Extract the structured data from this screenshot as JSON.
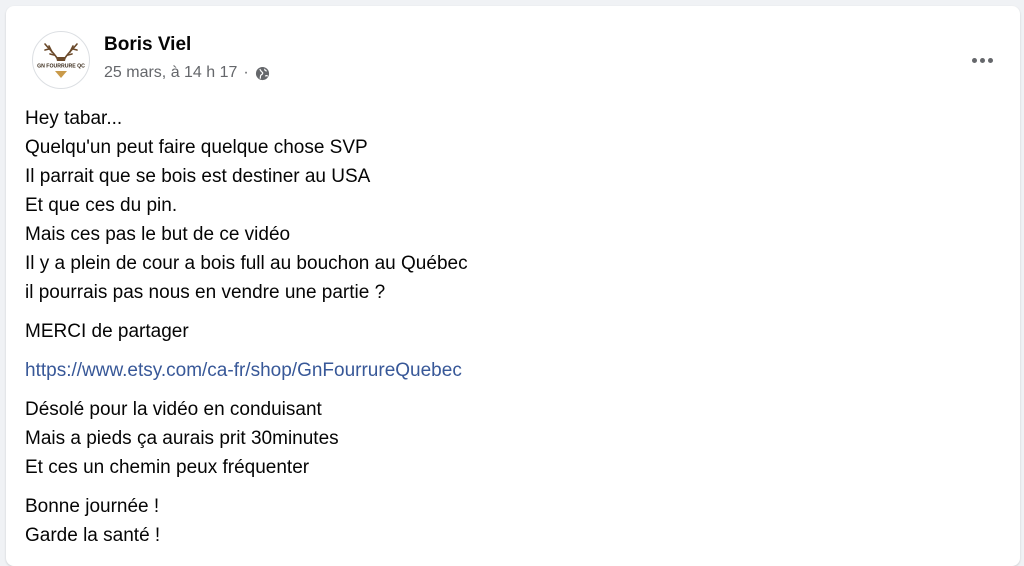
{
  "post": {
    "author": "Boris Viel",
    "avatar_text": "GN FOURRURE QC",
    "timestamp": "25 mars, à 14 h 17",
    "separator": "·",
    "privacy_icon": "globe-icon",
    "more_icon": "more-options-icon"
  },
  "body": {
    "para1": [
      "Hey tabar...",
      "Quelqu'un peut faire quelque chose SVP",
      "Il parrait que se bois est destiner au USA",
      "Et que ces du pin.",
      "Mais ces pas le but de ce vidéo",
      "Il y a plein de cour a bois full au bouchon au Québec",
      "il pourrais pas nous en vendre une partie ?"
    ],
    "para2": "MERCI de partager",
    "link": "https://www.etsy.com/ca-fr/shop/GnFourrureQuebec",
    "para3": [
      "Désolé pour la vidéo en conduisant",
      "Mais a pieds ça aurais prit 30minutes",
      "Et ces un chemin peux fréquenter"
    ],
    "para4": [
      "Bonne journée !",
      "Garde la santé !"
    ]
  },
  "colors": {
    "link": "#385898",
    "text": "#050505",
    "meta": "#65676b"
  }
}
